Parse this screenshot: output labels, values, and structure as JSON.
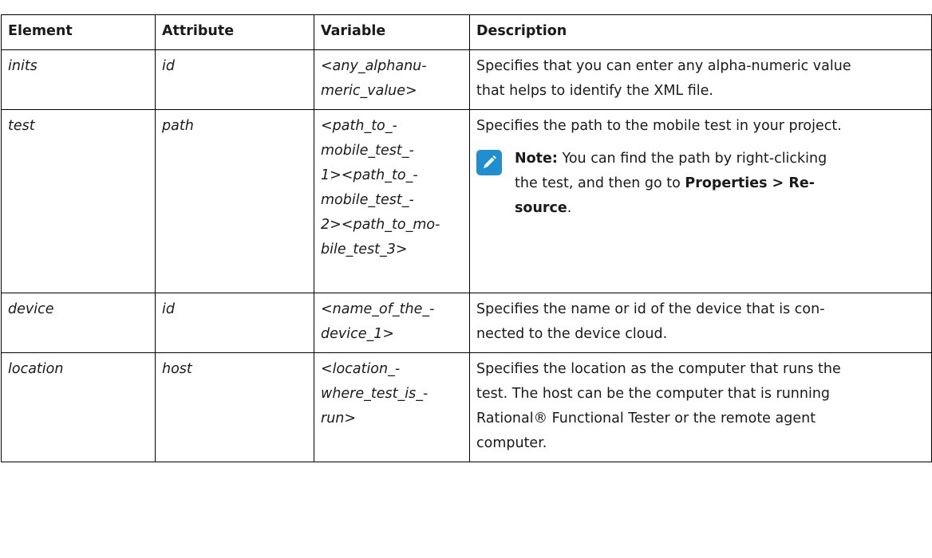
{
  "header": {
    "element": "Element",
    "attribute": "Attribute",
    "variable": "Variable",
    "description": "Description"
  },
  "rows": [
    {
      "element": "inits",
      "attribute": "id",
      "variable_lines": [
        "<any_alphanu-",
        "meric_value>"
      ],
      "description_lines": [
        "Specifies that you can enter any alpha-numeric value",
        "that helps to identify the XML file."
      ]
    },
    {
      "element": "test",
      "attribute": "path",
      "variable_lines": [
        "<path_to_-",
        "mobile_test_-",
        "1><path_to_-",
        "mobile_test_-",
        "2><path_to_mo-",
        "bile_test_3>"
      ],
      "description_lines": [
        "Specifies the path to the mobile test in your project."
      ],
      "note": {
        "icon": "pencil-note-icon",
        "label": "Note:",
        "line1_rest": " You can find the path by right-clicking",
        "line2_pre": "the test, and then go to ",
        "line2_bold": "Properties  >  Re-",
        "line3_bold": "source",
        "line3_post": "."
      }
    },
    {
      "element": "device",
      "attribute": "id",
      "variable_lines": [
        "<name_of_the_-",
        "device_1>"
      ],
      "description_lines": [
        "Specifies the name or id of the device that is con-",
        "nected to the device cloud."
      ]
    },
    {
      "element": "location",
      "attribute": "host",
      "variable_lines": [
        "<location_-",
        "where_test_is_-",
        "run>"
      ],
      "description_lines": [
        "Specifies the location as the computer that runs the",
        "test. The host can be the computer that is running",
        "Rational® Functional Tester or the remote agent",
        "computer."
      ]
    }
  ],
  "colors": {
    "note_icon": "#1f8fcf",
    "border": "#000000",
    "text": "#1a1a1a"
  }
}
